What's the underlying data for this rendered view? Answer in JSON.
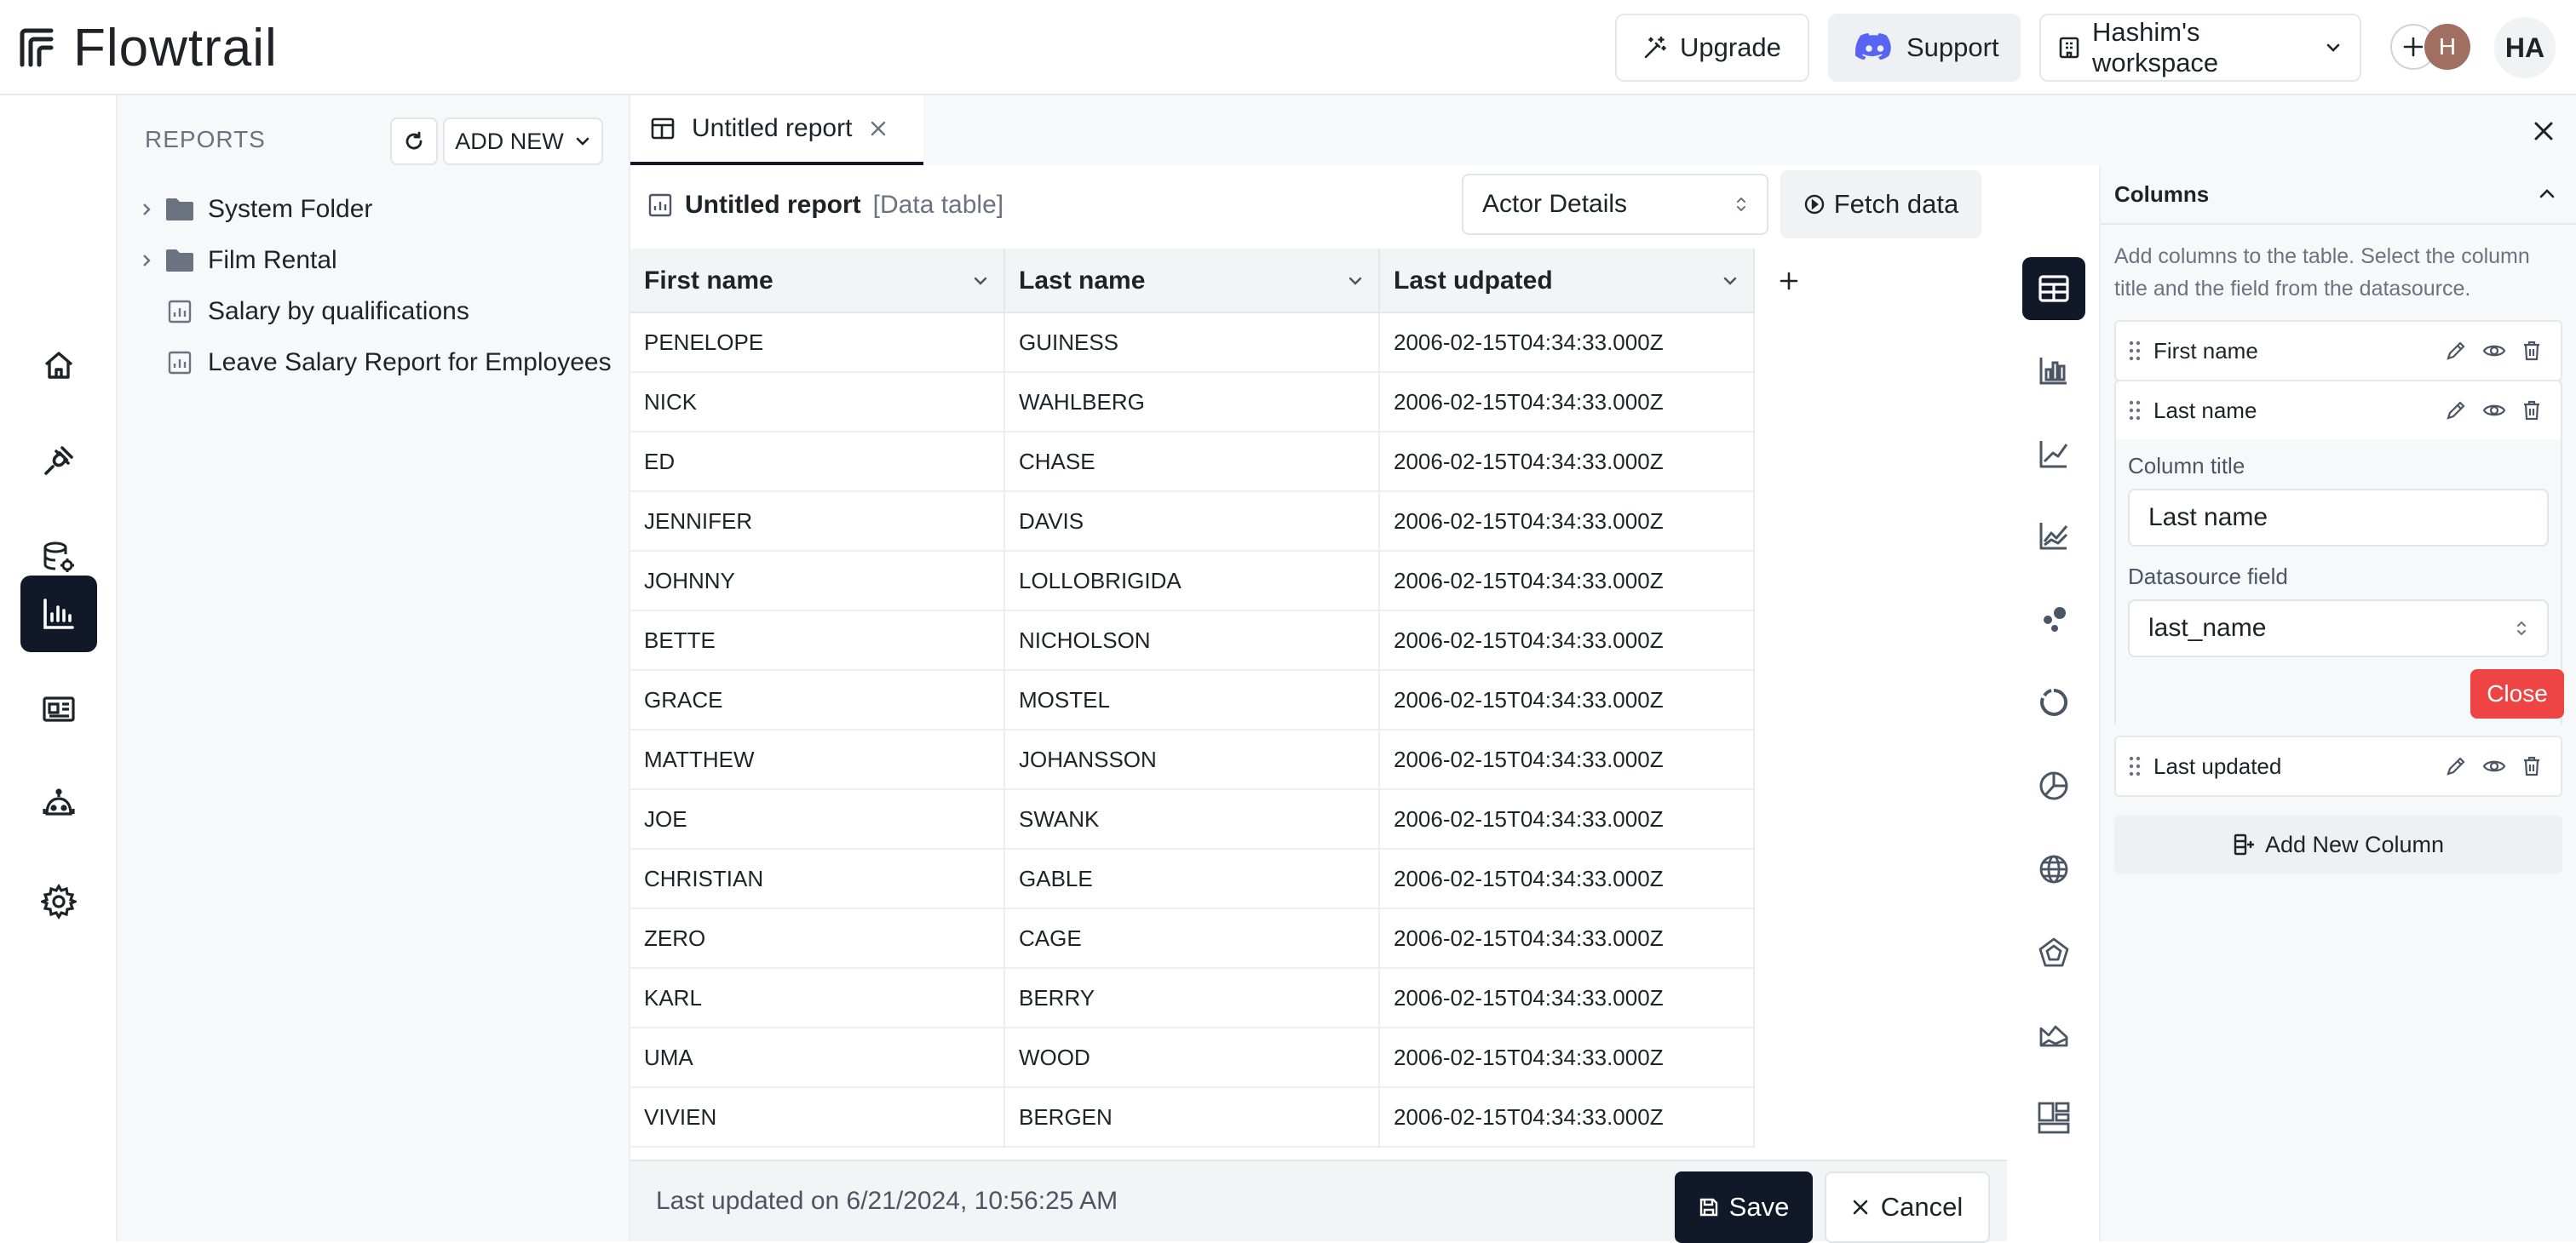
{
  "app": {
    "name": "Flowtrail"
  },
  "topbar": {
    "upgrade_label": "Upgrade",
    "support_label": "Support",
    "workspace_label": "Hashim's workspace",
    "avatar_small": "H",
    "avatar_initials": "HA"
  },
  "rail": {
    "items": [
      {
        "icon": "home-icon"
      },
      {
        "icon": "plug-icon"
      },
      {
        "icon": "database-settings-icon"
      },
      {
        "icon": "bar-chart-icon",
        "active": true
      },
      {
        "icon": "dashboard-icon"
      },
      {
        "icon": "bot-icon"
      },
      {
        "icon": "gear-icon"
      }
    ]
  },
  "sidebar": {
    "title": "REPORTS",
    "add_new_label": "ADD NEW",
    "items": [
      {
        "label": "System Folder",
        "type": "folder"
      },
      {
        "label": "Film Rental",
        "type": "folder"
      },
      {
        "label": "Salary by qualifications",
        "type": "report"
      },
      {
        "label": "Leave Salary Report for Employees",
        "type": "report"
      }
    ]
  },
  "tabs": [
    {
      "label": "Untitled report",
      "active": true
    }
  ],
  "report": {
    "title": "Untitled report",
    "type_label": "[Data table]",
    "datasource": "Actor Details",
    "fetch_label": "Fetch data"
  },
  "table": {
    "columns": [
      "First name",
      "Last name",
      "Last udpated"
    ],
    "rows": [
      [
        "PENELOPE",
        "GUINESS",
        "2006-02-15T04:34:33.000Z"
      ],
      [
        "NICK",
        "WAHLBERG",
        "2006-02-15T04:34:33.000Z"
      ],
      [
        "ED",
        "CHASE",
        "2006-02-15T04:34:33.000Z"
      ],
      [
        "JENNIFER",
        "DAVIS",
        "2006-02-15T04:34:33.000Z"
      ],
      [
        "JOHNNY",
        "LOLLOBRIGIDA",
        "2006-02-15T04:34:33.000Z"
      ],
      [
        "BETTE",
        "NICHOLSON",
        "2006-02-15T04:34:33.000Z"
      ],
      [
        "GRACE",
        "MOSTEL",
        "2006-02-15T04:34:33.000Z"
      ],
      [
        "MATTHEW",
        "JOHANSSON",
        "2006-02-15T04:34:33.000Z"
      ],
      [
        "JOE",
        "SWANK",
        "2006-02-15T04:34:33.000Z"
      ],
      [
        "CHRISTIAN",
        "GABLE",
        "2006-02-15T04:34:33.000Z"
      ],
      [
        "ZERO",
        "CAGE",
        "2006-02-15T04:34:33.000Z"
      ],
      [
        "KARL",
        "BERRY",
        "2006-02-15T04:34:33.000Z"
      ],
      [
        "UMA",
        "WOOD",
        "2006-02-15T04:34:33.000Z"
      ],
      [
        "VIVIEN",
        "BERGEN",
        "2006-02-15T04:34:33.000Z"
      ]
    ]
  },
  "footer": {
    "last_updated": "Last updated on 6/21/2024, 10:56:25 AM",
    "save_label": "Save",
    "cancel_label": "Cancel"
  },
  "chart_types": [
    {
      "icon": "table-icon",
      "active": true
    },
    {
      "icon": "bar-chart-icon"
    },
    {
      "icon": "line-chart-icon"
    },
    {
      "icon": "area-line-chart-icon"
    },
    {
      "icon": "scatter-chart-icon"
    },
    {
      "icon": "doughnut-chart-icon"
    },
    {
      "icon": "pie-chart-icon"
    },
    {
      "icon": "globe-map-icon"
    },
    {
      "icon": "radar-chart-icon"
    },
    {
      "icon": "area-chart-icon"
    },
    {
      "icon": "layout-icon"
    }
  ],
  "columns_panel": {
    "title": "Columns",
    "description": "Add columns to the table. Select the column title and the field from the datasource.",
    "columns": [
      {
        "name": "First name"
      },
      {
        "name": "Last name",
        "expanded": true
      },
      {
        "name": "Last updated"
      }
    ],
    "editor": {
      "title_label": "Column title",
      "title_value": "Last name",
      "field_label": "Datasource field",
      "field_value": "last_name",
      "close_label": "Close"
    },
    "add_column_label": "Add New Column"
  },
  "colors": {
    "primary": "#111827",
    "danger": "#ef4444",
    "accent_discord": "#5865F2"
  }
}
